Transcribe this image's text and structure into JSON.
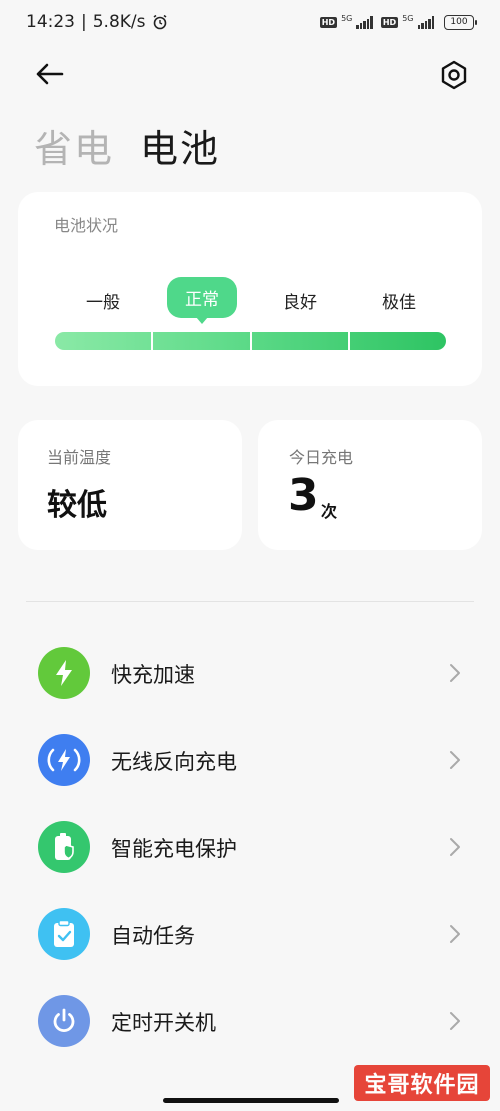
{
  "status_bar": {
    "time": "14:23",
    "separator": "|",
    "speed": "5.8K/s",
    "hd_label": "HD",
    "network": "5G",
    "battery": "100"
  },
  "tabs": [
    {
      "label": "省电",
      "active": false
    },
    {
      "label": "电池",
      "active": true
    }
  ],
  "battery_status": {
    "title": "电池状况",
    "levels": [
      "一般",
      "正常",
      "良好",
      "极佳"
    ],
    "current_level": "正常",
    "meter_colors": [
      "#8ae9a6",
      "#2ec463"
    ]
  },
  "temperature": {
    "label": "当前温度",
    "value": "较低"
  },
  "charges_today": {
    "label": "今日充电",
    "value": "3",
    "unit": "次"
  },
  "menu": [
    {
      "label": "快充加速",
      "icon": "lightning-icon",
      "color": "#62c93b"
    },
    {
      "label": "无线反向充电",
      "icon": "wireless-charge-icon",
      "color": "#3f7ef0"
    },
    {
      "label": "智能充电保护",
      "icon": "battery-shield-icon",
      "color": "#34c76e"
    },
    {
      "label": "自动任务",
      "icon": "clipboard-check-icon",
      "color": "#3fc1f2"
    },
    {
      "label": "定时开关机",
      "icon": "power-icon",
      "color": "#6f97e6"
    }
  ],
  "watermark": "宝哥软件园"
}
